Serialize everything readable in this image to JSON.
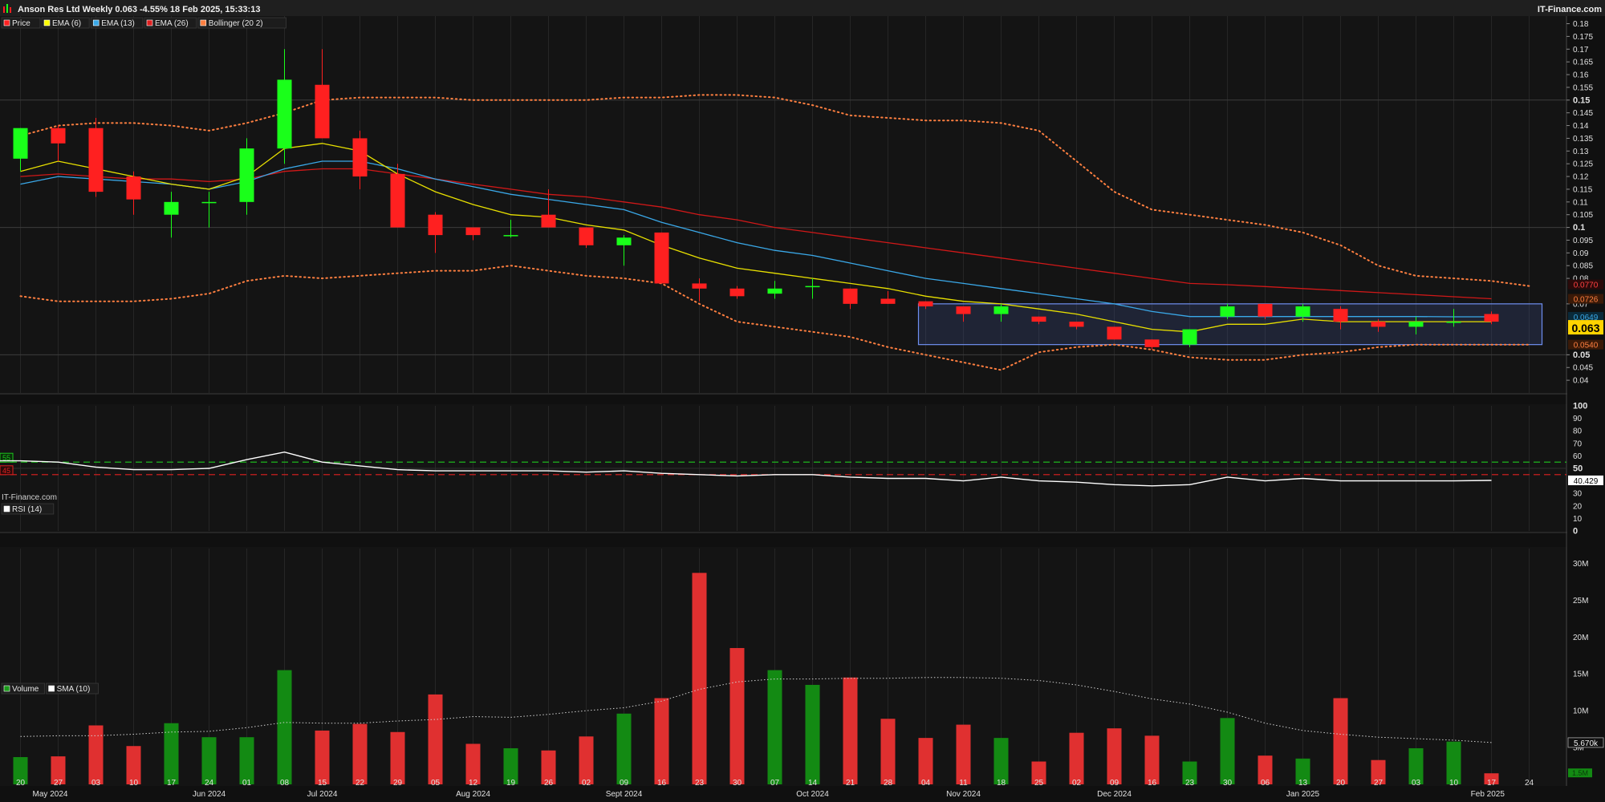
{
  "header": {
    "title": "Anson Res Ltd Weekly 0.063 -4.55% 18 Feb 2025, 15:33:13",
    "brand": "IT-Finance.com",
    "watermark": "IT-Finance.com"
  },
  "legend_price": [
    {
      "label": "Price",
      "color": "#ff2020"
    },
    {
      "label": "EMA (6)",
      "color": "#ffff00"
    },
    {
      "label": "EMA (13)",
      "color": "#3aa8e8"
    },
    {
      "label": "EMA (26)",
      "color": "#e02020"
    },
    {
      "label": "Bollinger (20 2)",
      "color": "#ff7f40"
    }
  ],
  "legend_rsi": [
    {
      "label": "RSI (14)",
      "color": "#ffffff"
    }
  ],
  "legend_volume": [
    {
      "label": "Volume",
      "color": "#1a9a1a"
    },
    {
      "label": "SMA (10)",
      "color": "#ffffff"
    }
  ],
  "colors": {
    "up": "#1aff1a",
    "down": "#ff2020",
    "vol_up": "#138a13",
    "vol_down": "#e03030",
    "ema6": "#e8e000",
    "ema13": "#3aa8e8",
    "ema26": "#d01818",
    "bollinger": "#ff7f40",
    "rsi": "#ffffff",
    "last_price_bg": "#ffd400"
  },
  "chart_data": {
    "type": "candlestick",
    "x_ticks_day": [
      "20",
      "27",
      "03",
      "10",
      "17",
      "24",
      "01",
      "08",
      "15",
      "22",
      "29",
      "05",
      "12",
      "19",
      "26",
      "02",
      "09",
      "16",
      "23",
      "30",
      "07",
      "14",
      "21",
      "28",
      "04",
      "11",
      "18",
      "25",
      "02",
      "09",
      "16",
      "23",
      "30",
      "06",
      "13",
      "20",
      "27",
      "03",
      "10",
      "17",
      "24"
    ],
    "x_ticks_month": [
      "May 2024",
      "Jun 2024",
      "Jul 2024",
      "Aug 2024",
      "Sept 2024",
      "Oct 2024",
      "Nov 2024",
      "Dec 2024",
      "Jan 2025",
      "Feb 2025"
    ],
    "price_axis": {
      "ylim": [
        0.035,
        0.183
      ],
      "ticks": [
        "0.18",
        "0.175",
        "0.17",
        "0.165",
        "0.16",
        "0.155",
        "0.15",
        "0.145",
        "0.14",
        "0.135",
        "0.13",
        "0.125",
        "0.12",
        "0.115",
        "0.11",
        "0.105",
        "0.1",
        "0.095",
        "0.09",
        "0.085",
        "0.08",
        "0.07",
        "0.05",
        "0.045",
        "0.04"
      ],
      "major_ticks": [
        "0.15",
        "0.1",
        "0.05"
      ]
    },
    "candles": [
      [
        0.127,
        0.139,
        0.122,
        0.139
      ],
      [
        0.139,
        0.14,
        0.126,
        0.133
      ],
      [
        0.139,
        0.143,
        0.112,
        0.114
      ],
      [
        0.12,
        0.122,
        0.105,
        0.111
      ],
      [
        0.105,
        0.114,
        0.096,
        0.11
      ],
      [
        0.11,
        0.114,
        0.1,
        0.11
      ],
      [
        0.11,
        0.135,
        0.105,
        0.131
      ],
      [
        0.131,
        0.17,
        0.125,
        0.158
      ],
      [
        0.156,
        0.17,
        0.148,
        0.135
      ],
      [
        0.135,
        0.138,
        0.115,
        0.12
      ],
      [
        0.121,
        0.125,
        0.1,
        0.1
      ],
      [
        0.105,
        0.106,
        0.09,
        0.097
      ],
      [
        0.1,
        0.1,
        0.095,
        0.097
      ],
      [
        0.097,
        0.103,
        0.096,
        0.097
      ],
      [
        0.105,
        0.115,
        0.1,
        0.1
      ],
      [
        0.1,
        0.1,
        0.092,
        0.093
      ],
      [
        0.093,
        0.097,
        0.085,
        0.096
      ],
      [
        0.098,
        0.098,
        0.078,
        0.078
      ],
      [
        0.078,
        0.08,
        0.071,
        0.076
      ],
      [
        0.076,
        0.077,
        0.072,
        0.073
      ],
      [
        0.074,
        0.079,
        0.072,
        0.076
      ],
      [
        0.077,
        0.08,
        0.072,
        0.077
      ],
      [
        0.076,
        0.076,
        0.068,
        0.07
      ],
      [
        0.072,
        0.075,
        0.07,
        0.07
      ],
      [
        0.071,
        0.071,
        0.068,
        0.069
      ],
      [
        0.069,
        0.069,
        0.063,
        0.066
      ],
      [
        0.066,
        0.07,
        0.063,
        0.069
      ],
      [
        0.065,
        0.065,
        0.062,
        0.063
      ],
      [
        0.063,
        0.063,
        0.06,
        0.061
      ],
      [
        0.061,
        0.061,
        0.056,
        0.056
      ],
      [
        0.056,
        0.056,
        0.052,
        0.053
      ],
      [
        0.054,
        0.06,
        0.053,
        0.06
      ],
      [
        0.065,
        0.07,
        0.064,
        0.069
      ],
      [
        0.07,
        0.07,
        0.064,
        0.065
      ],
      [
        0.065,
        0.07,
        0.063,
        0.069
      ],
      [
        0.068,
        0.069,
        0.06,
        0.063
      ],
      [
        0.063,
        0.064,
        0.059,
        0.061
      ],
      [
        0.061,
        0.065,
        0.058,
        0.063
      ],
      [
        0.063,
        0.068,
        0.061,
        0.063
      ],
      [
        0.066,
        0.067,
        0.062,
        0.063
      ]
    ],
    "ema6": [
      0.122,
      0.126,
      0.123,
      0.12,
      0.117,
      0.115,
      0.12,
      0.131,
      0.133,
      0.13,
      0.121,
      0.114,
      0.109,
      0.105,
      0.104,
      0.101,
      0.099,
      0.093,
      0.088,
      0.084,
      0.082,
      0.08,
      0.078,
      0.076,
      0.073,
      0.071,
      0.07,
      0.068,
      0.066,
      0.063,
      0.06,
      0.059,
      0.062,
      0.062,
      0.064,
      0.063,
      0.063,
      0.063,
      0.063,
      0.063
    ],
    "ema13": [
      0.117,
      0.12,
      0.119,
      0.118,
      0.117,
      0.115,
      0.118,
      0.123,
      0.126,
      0.126,
      0.123,
      0.119,
      0.116,
      0.113,
      0.111,
      0.109,
      0.107,
      0.102,
      0.098,
      0.094,
      0.091,
      0.089,
      0.086,
      0.083,
      0.08,
      0.078,
      0.076,
      0.074,
      0.072,
      0.07,
      0.067,
      0.065,
      0.065,
      0.065,
      0.065,
      0.065,
      0.065,
      0.065,
      0.0649,
      0.0649
    ],
    "ema26": [
      0.12,
      0.121,
      0.12,
      0.119,
      0.119,
      0.118,
      0.119,
      0.122,
      0.123,
      0.123,
      0.121,
      0.119,
      0.117,
      0.115,
      0.113,
      0.112,
      0.11,
      0.108,
      0.105,
      0.103,
      0.1,
      0.098,
      0.096,
      0.094,
      0.092,
      0.09,
      0.088,
      0.086,
      0.084,
      0.082,
      0.08,
      0.078,
      0.0775,
      0.0768,
      0.076,
      0.0752,
      0.0744,
      0.0736,
      0.0728,
      0.072
    ],
    "bb_upper": [
      0.136,
      0.14,
      0.141,
      0.141,
      0.14,
      0.138,
      0.141,
      0.145,
      0.15,
      0.151,
      0.151,
      0.151,
      0.15,
      0.15,
      0.15,
      0.15,
      0.151,
      0.151,
      0.152,
      0.152,
      0.151,
      0.148,
      0.144,
      0.143,
      0.142,
      0.142,
      0.141,
      0.138,
      0.126,
      0.114,
      0.107,
      0.105,
      0.103,
      0.101,
      0.098,
      0.093,
      0.085,
      0.081,
      0.08,
      0.079,
      0.077
    ],
    "bb_lower": [
      0.073,
      0.071,
      0.071,
      0.071,
      0.072,
      0.074,
      0.079,
      0.081,
      0.08,
      0.081,
      0.082,
      0.083,
      0.083,
      0.085,
      0.083,
      0.081,
      0.08,
      0.078,
      0.07,
      0.063,
      0.061,
      0.059,
      0.057,
      0.053,
      0.05,
      0.047,
      0.044,
      0.051,
      0.053,
      0.054,
      0.052,
      0.049,
      0.048,
      0.048,
      0.05,
      0.051,
      0.053,
      0.054,
      0.054,
      0.054,
      0.054
    ],
    "rsi": {
      "ylim": [
        0,
        100
      ],
      "ticks": [
        "100",
        "90",
        "80",
        "70",
        "60",
        "50",
        "40",
        "30",
        "20",
        "10",
        "0"
      ],
      "overbought": 55,
      "oversold": 45,
      "values": [
        56,
        55,
        51,
        49,
        49,
        50,
        57,
        63,
        55,
        52,
        49,
        48,
        48,
        48,
        48,
        47,
        48,
        46,
        45,
        44,
        45,
        45,
        43,
        42,
        42,
        40,
        43,
        40,
        39,
        37,
        36,
        37,
        43,
        40,
        42,
        40,
        40,
        40,
        40,
        40.4
      ]
    },
    "volume": {
      "ylim": [
        0,
        32
      ],
      "ticks": [
        "30M",
        "25M",
        "20M",
        "15M",
        "10M",
        "5M"
      ],
      "values": [
        3.7,
        3.8,
        8.0,
        5.2,
        8.3,
        6.4,
        6.4,
        15.5,
        7.3,
        8.2,
        7.1,
        12.2,
        5.5,
        4.9,
        4.6,
        6.5,
        9.6,
        11.7,
        28.7,
        18.5,
        15.5,
        13.5,
        14.5,
        8.9,
        6.3,
        8.1,
        6.3,
        3.1,
        7.0,
        7.6,
        6.6,
        3.1,
        9.0,
        3.9,
        3.5,
        11.7,
        3.3,
        4.9,
        5.8,
        1.5
      ],
      "sma10": [
        6.5,
        6.6,
        6.6,
        6.8,
        7.1,
        7.2,
        7.7,
        8.4,
        8.3,
        8.3,
        8.6,
        8.8,
        9.2,
        9.1,
        9.5,
        10.0,
        10.4,
        11.3,
        12.9,
        13.9,
        14.3,
        14.3,
        14.4,
        14.4,
        14.5,
        14.5,
        14.4,
        14.1,
        13.5,
        12.6,
        11.6,
        10.9,
        9.8,
        8.3,
        7.3,
        6.8,
        6.4,
        6.2,
        6.0,
        5.67
      ]
    },
    "last_labels": {
      "price": "0.063",
      "ema26": "0.0770",
      "bb_upper": "0.0726",
      "ema13": "0.0649",
      "bb_lower": "0.0540",
      "rsi": "40.429",
      "volume_sma": "5.670k",
      "volume_last": "1.5M"
    },
    "rsi_levels": {
      "upper": "55",
      "lower": "45"
    },
    "range_box": {
      "x_start_index": 24,
      "x_end_index": 40,
      "y_top": 0.07,
      "y_bottom": 0.054
    }
  }
}
